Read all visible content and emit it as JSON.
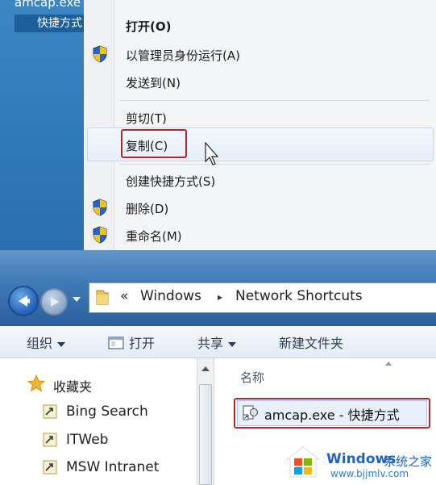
{
  "desktop": {
    "file_name_line1": "amcap.exe -",
    "file_name_line2": "快捷方式"
  },
  "context_menu": {
    "items": [
      {
        "label": "打开(O)",
        "bold": true,
        "shield": false
      },
      {
        "label": "以管理员身份运行(A)",
        "bold": false,
        "shield": true
      },
      {
        "label": "发送到(N)",
        "bold": false,
        "shield": false
      },
      {
        "label": "剪切(T)",
        "bold": false,
        "shield": false
      },
      {
        "label": "复制(C)",
        "bold": false,
        "shield": false,
        "highlighted": true
      },
      {
        "label": "创建快捷方式(S)",
        "bold": false,
        "shield": false
      },
      {
        "label": "删除(D)",
        "bold": false,
        "shield": true
      },
      {
        "label": "重命名(M)",
        "bold": false,
        "shield": true
      }
    ]
  },
  "explorer": {
    "breadcrumb": {
      "overflow": "«",
      "parts": [
        "Windows",
        "Network Shortcuts"
      ],
      "separator": "▸"
    },
    "toolbar": {
      "organize": "组织",
      "open": "打开",
      "share": "共享",
      "new_folder": "新建文件夹"
    },
    "nav": {
      "favorites": "收藏夹",
      "items": [
        "Bing Search",
        "ITWeb",
        "MSW Intranet"
      ]
    },
    "content": {
      "column_name": "名称",
      "file": "amcap.exe - 快捷方式"
    }
  },
  "watermark": {
    "brand": "Windows",
    "suffix": "系统之家",
    "url": "www.bjjmlv.com"
  },
  "colors": {
    "highlight_border": "#b3262d",
    "desktop_blue": "#2f78b8",
    "watermark_blue": "#1a64c8"
  }
}
